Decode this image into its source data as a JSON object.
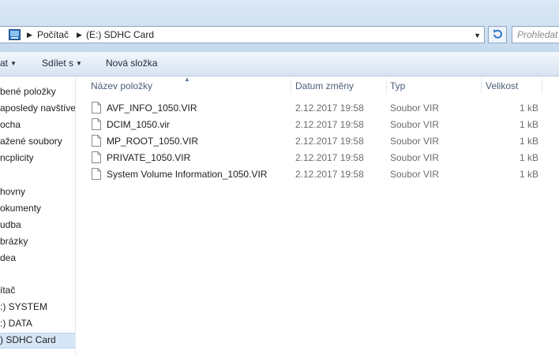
{
  "address_bar": {
    "crumbs": [
      "Počítač",
      "(E:) SDHC Card"
    ],
    "search_placeholder": "Prohledat"
  },
  "toolbar": {
    "items": [
      "at",
      "Sdílet s",
      "Nová složka"
    ]
  },
  "nav": {
    "items": [
      "bené položky",
      "aposledy navštíver",
      "ocha",
      "ažené soubory",
      "ncplicity",
      "hovny",
      "okumenty",
      "udba",
      "brázky",
      "dea",
      "ítač",
      ":) SYSTEM",
      ":) DATA",
      ") SDHC Card"
    ],
    "selected": ") SDHC Card"
  },
  "file_list": {
    "columns": [
      "Název položky",
      "Datum změny",
      "Typ",
      "Velikost"
    ],
    "rows": [
      {
        "name": "AVF_INFO_1050.VIR",
        "date": "2.12.2017 19:58",
        "type": "Soubor VIR",
        "size": "1 kB"
      },
      {
        "name": "DCIM_1050.vir",
        "date": "2.12.2017 19:58",
        "type": "Soubor VIR",
        "size": "1 kB"
      },
      {
        "name": "MP_ROOT_1050.VIR",
        "date": "2.12.2017 19:58",
        "type": "Soubor VIR",
        "size": "1 kB"
      },
      {
        "name": "PRIVATE_1050.VIR",
        "date": "2.12.2017 19:58",
        "type": "Soubor VIR",
        "size": "1 kB"
      },
      {
        "name": "System Volume Information_1050.VIR",
        "date": "2.12.2017 19:58",
        "type": "Soubor VIR",
        "size": "1 kB"
      }
    ]
  },
  "icons": {
    "addr_folder": "drive-icon",
    "refresh": "refresh-icon",
    "file": "file-icon"
  }
}
